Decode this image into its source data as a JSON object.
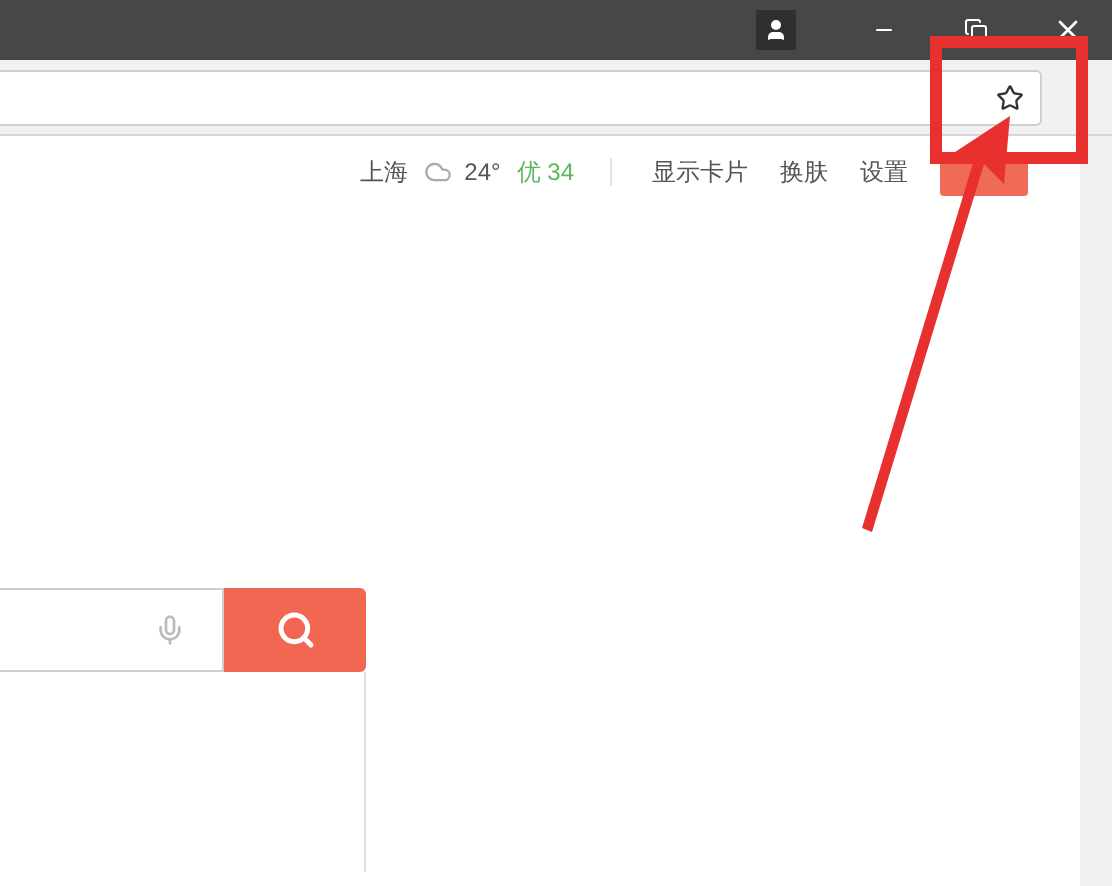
{
  "toolbar": {
    "weather": {
      "city": "上海",
      "temperature": "24°",
      "air_quality": "优 34"
    },
    "links": [
      "显示卡片",
      "换肤",
      "设置"
    ]
  }
}
